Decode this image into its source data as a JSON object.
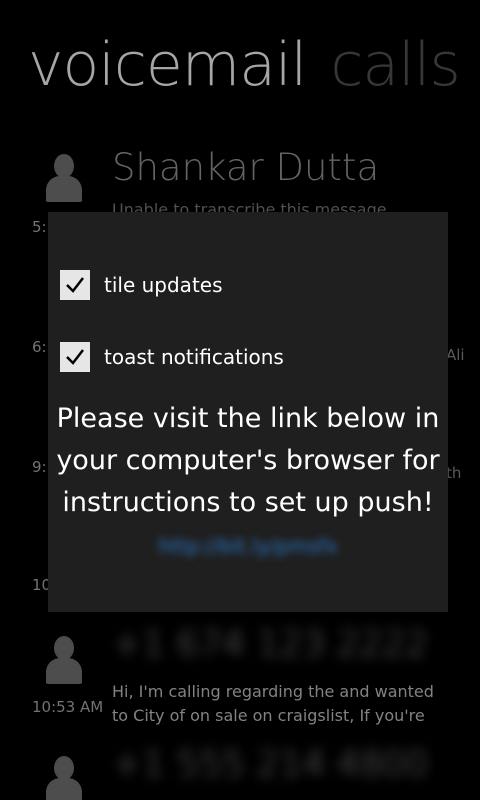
{
  "pivot": {
    "active": "voicemail",
    "inactive": "calls"
  },
  "voicemails": [
    {
      "name": "Shankar Dutta",
      "time": "5:",
      "transcript": "Unable to transcribe this message"
    },
    {
      "time": "6:",
      "edge": "Ali"
    },
    {
      "time": "9:",
      "edge": "th"
    },
    {
      "time": "10"
    },
    {
      "name": "+1 674 123 2222",
      "time": "10:53 AM",
      "transcript_line1": "Hi, I'm calling regarding the and wanted",
      "transcript_line2": "to City of on sale on craigslist, If you're"
    },
    {
      "name": "+1 555 214 4800"
    }
  ],
  "dialog": {
    "tile_updates_label": "tile updates",
    "toast_notifications_label": "toast notifications",
    "message_line1": "Please visit the link below in",
    "message_line2": "your computer's browser for",
    "message_line3": "instructions to set up push!",
    "link": "http://bit.ly/pmsfx"
  },
  "icons": {
    "checkbox": "check-icon",
    "avatar": "person-icon"
  },
  "colors": {
    "background": "#000000",
    "dialog": "#1f1f1f",
    "link": "#2a78c8",
    "checkbox": "#e6e6e6"
  }
}
